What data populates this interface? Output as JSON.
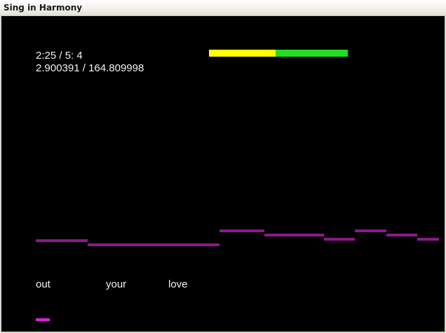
{
  "window": {
    "title": "Sing in Harmony"
  },
  "info": {
    "time_line": "2:25 / 5: 4",
    "position_line": "2.900391 / 164.809998"
  },
  "progress": {
    "yellow_color": "#ffff00",
    "green_color": "#22dd22",
    "yellow_fraction": 0.48
  },
  "notes": {
    "color": "#8b1a8b"
  },
  "lyrics": [
    "out",
    "your",
    "love"
  ],
  "pitch_marker": {
    "color": "#e020e0"
  }
}
